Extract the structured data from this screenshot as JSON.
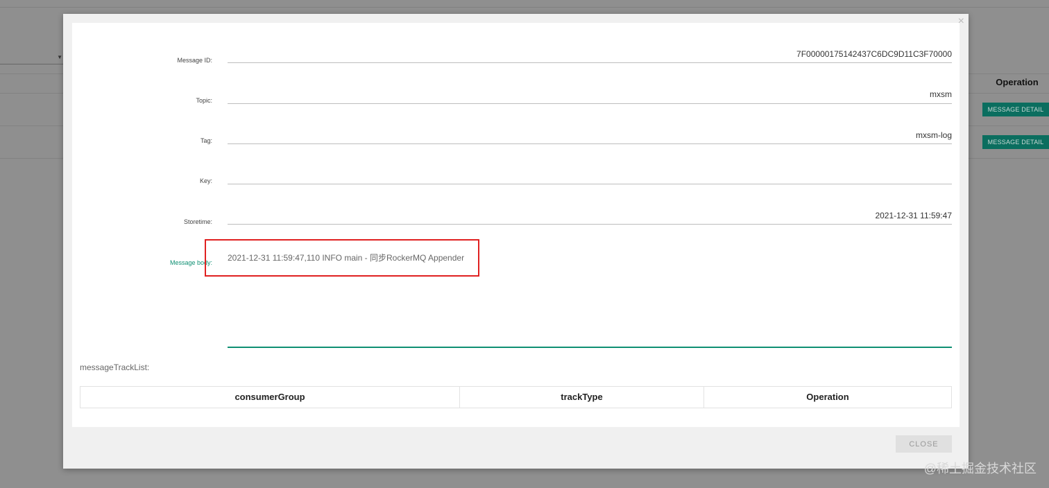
{
  "background": {
    "operation_header": "Operation",
    "rows": [
      {
        "button_label": "MESSAGE DETAIL"
      },
      {
        "button_label": "MESSAGE DETAIL"
      }
    ]
  },
  "modal": {
    "close_x": "×",
    "fields": {
      "message_id": {
        "label": "Message ID:",
        "value": "7F00000175142437C6DC9D11C3F70000"
      },
      "topic": {
        "label": "Topic:",
        "value": "mxsm"
      },
      "tag": {
        "label": "Tag:",
        "value": "mxsm-log"
      },
      "key": {
        "label": "Key:",
        "value": ""
      },
      "storetime": {
        "label": "Storetime:",
        "value": "2021-12-31 11:59:47"
      },
      "message_body": {
        "label": "Message body:",
        "value": "2021-12-31 11:59:47,110 INFO main - 同步RockerMQ Appender"
      }
    },
    "track_list": {
      "title": "messageTrackList:",
      "columns": [
        "consumerGroup",
        "trackType",
        "Operation"
      ]
    },
    "close_button_label": "CLOSE"
  },
  "watermark": "@稀土掘金技术社区",
  "colors": {
    "accent": "#0d8f72",
    "button_bg": "#0b6e5f",
    "highlight": "#e02020"
  }
}
